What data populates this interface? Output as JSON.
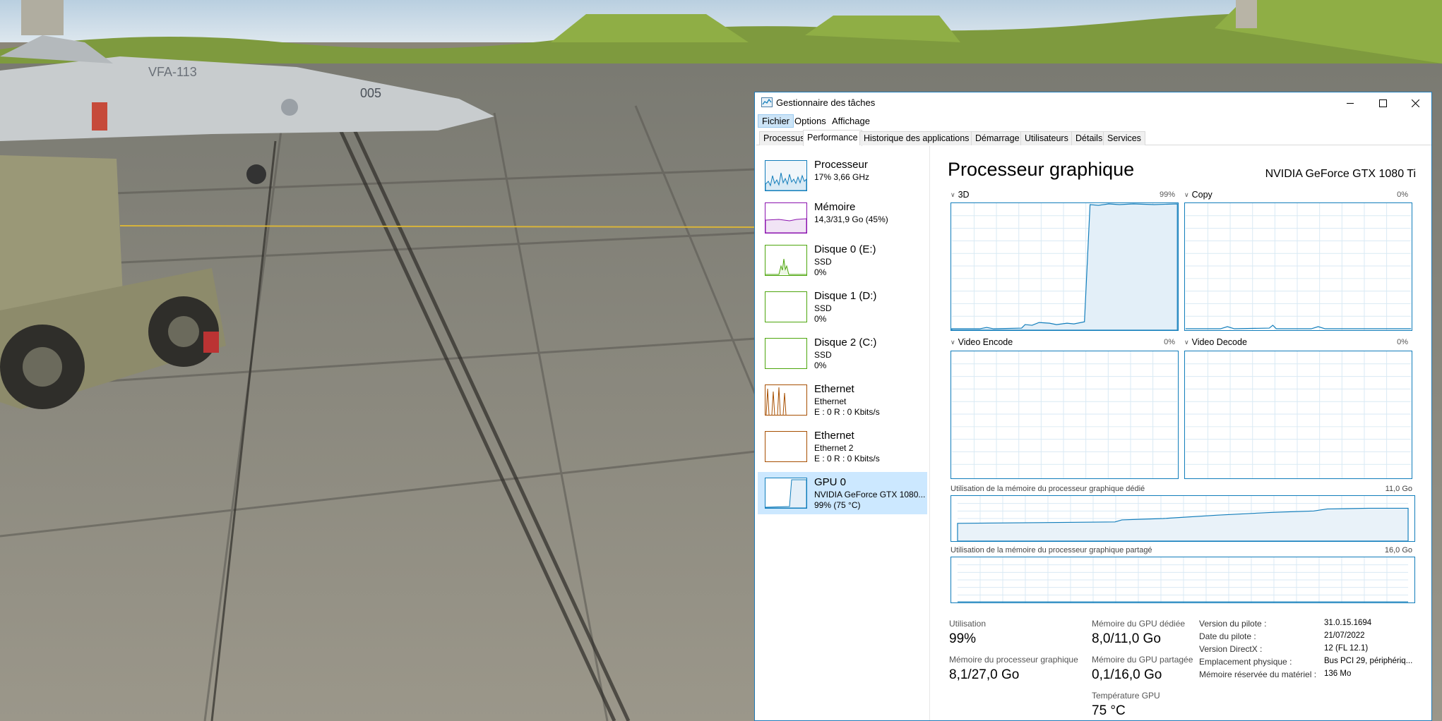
{
  "background": {
    "aircraft_tail_text": "VFA-113",
    "aircraft_number": "005"
  },
  "window": {
    "title": "Gestionnaire des tâches",
    "minimize_icon": "minimize-icon",
    "maximize_icon": "maximize-icon",
    "close_icon": "close-icon"
  },
  "menu": [
    "Fichier",
    "Options",
    "Affichage"
  ],
  "tabs": [
    "Processus",
    "Performance",
    "Historique des applications",
    "Démarrage",
    "Utilisateurs",
    "Détails",
    "Services"
  ],
  "sidebar": {
    "items": [
      {
        "title": "Processeur",
        "line2": "17%  3,66 GHz",
        "line3": "",
        "color": "#117dbb"
      },
      {
        "title": "Mémoire",
        "line2": "14,3/31,9 Go (45%)",
        "line3": "",
        "color": "#8b12ae"
      },
      {
        "title": "Disque 0 (E:)",
        "line2": "SSD",
        "line3": "0%",
        "color": "#4da60c"
      },
      {
        "title": "Disque 1 (D:)",
        "line2": "SSD",
        "line3": "0%",
        "color": "#4da60c"
      },
      {
        "title": "Disque 2 (C:)",
        "line2": "SSD",
        "line3": "0%",
        "color": "#4da60c"
      },
      {
        "title": "Ethernet",
        "line2": "Ethernet",
        "line3": "E : 0  R : 0 Kbits/s",
        "color": "#a74f01"
      },
      {
        "title": "Ethernet",
        "line2": "Ethernet 2",
        "line3": "E : 0  R : 0 Kbits/s",
        "color": "#a74f01"
      },
      {
        "title": "GPU 0",
        "line2": "NVIDIA GeForce GTX 1080...",
        "line3": "99% (75 °C)",
        "color": "#117dbb"
      }
    ]
  },
  "main": {
    "title": "Processeur graphique",
    "gpu_name": "NVIDIA GeForce GTX 1080 Ti",
    "engines": [
      {
        "label": "3D",
        "pct": "99%"
      },
      {
        "label": "Copy",
        "pct": "0%"
      },
      {
        "label": "Video Encode",
        "pct": "0%"
      },
      {
        "label": "Video Decode",
        "pct": "0%"
      }
    ],
    "dedicated_label": "Utilisation de la mémoire du processeur graphique dédié",
    "dedicated_max": "11,0 Go",
    "shared_label": "Utilisation de la mémoire du processeur graphique partagé",
    "shared_max": "16,0 Go",
    "stats": {
      "utilisation_label": "Utilisation",
      "utilisation_value": "99%",
      "gpu_mem_label": "Mémoire du processeur graphique",
      "gpu_mem_value": "8,1/27,0 Go",
      "dedicated_mem_label": "Mémoire du GPU dédiée",
      "dedicated_mem_value": "8,0/11,0 Go",
      "shared_mem_label": "Mémoire du GPU partagée",
      "shared_mem_value": "0,1/16,0 Go",
      "temp_label": "Température GPU",
      "temp_value": "75 °C"
    },
    "properties": [
      {
        "label": "Version du pilote :",
        "value": "31.0.15.1694"
      },
      {
        "label": "Date du pilote :",
        "value": "21/07/2022"
      },
      {
        "label": "Version DirectX :",
        "value": "12 (FL 12.1)"
      },
      {
        "label": "Emplacement physique :",
        "value": "Bus PCI 29, périphériq..."
      },
      {
        "label": "Mémoire réservée du matériel :",
        "value": "136 Mo"
      }
    ]
  },
  "accent_color": "#117dbb",
  "annotation_arrow_color": "#f5b400"
}
